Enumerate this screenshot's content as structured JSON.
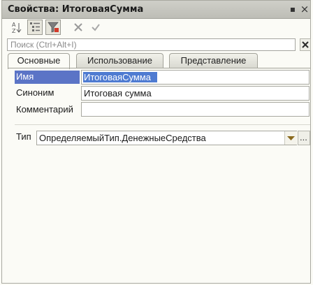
{
  "window": {
    "title": "Свойства: ИтоговаяСумма",
    "pin_glyph": "▪",
    "close_glyph": "×"
  },
  "toolbar": {
    "buttons": [
      {
        "name": "sort-az-icon"
      },
      {
        "name": "categories-icon"
      },
      {
        "name": "filter-icon"
      },
      {
        "name": "cancel-icon"
      },
      {
        "name": "apply-checkmark-icon"
      }
    ]
  },
  "search": {
    "placeholder": "Поиск (Ctrl+Alt+I)"
  },
  "tabs": [
    {
      "label": "Основные",
      "active": true
    },
    {
      "label": "Использование",
      "active": false
    },
    {
      "label": "Представление",
      "active": false
    }
  ],
  "fields": {
    "name": {
      "label": "Имя",
      "value": "ИтоговаяСумма"
    },
    "synonym": {
      "label": "Синоним",
      "value": "Итоговая сумма"
    },
    "comment": {
      "label": "Комментарий",
      "value": ""
    },
    "type": {
      "label": "Тип",
      "value": "ОпределяемыйТип.ДенежныеСредства",
      "more_label": "..."
    }
  },
  "colors": {
    "selection": "#4f7bd1",
    "label_highlight": "#5b74c6",
    "dropdown_arrow": "#8a6a1e",
    "cancel_x": "#9a9a9a",
    "clear_x": "#2a2a2a"
  }
}
